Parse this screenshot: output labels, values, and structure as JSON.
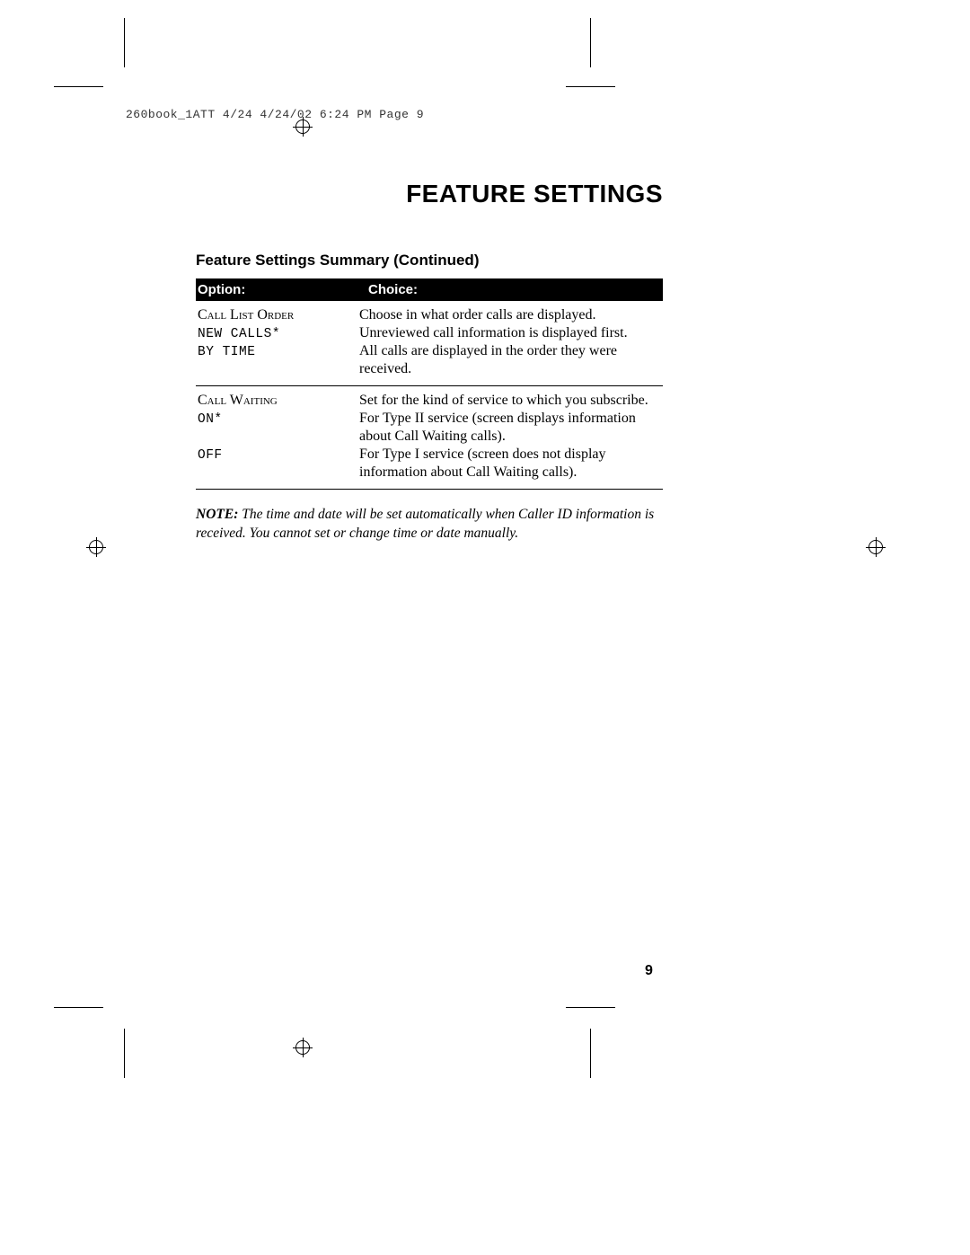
{
  "runhead": "260book_1ATT 4/24  4/24/02  6:24 PM  Page 9",
  "title": "FEATURE SETTINGS",
  "subtitle": "Feature Settings Summary (Continued)",
  "table": {
    "headers": {
      "option": "Option:",
      "choice": "Choice:"
    },
    "rows": [
      {
        "option_title": "Call List Order",
        "option_lines": [
          "NEW CALLS*",
          "BY TIME"
        ],
        "choice_lines": [
          "Choose in what order calls are displayed.",
          "Unreviewed call information is displayed first.",
          "All calls are displayed in the order they were received."
        ]
      },
      {
        "option_title": "Call Waiting",
        "option_lines": [
          "ON*",
          "",
          "OFF"
        ],
        "choice_lines": [
          "Set for the kind of service to which you subscribe.",
          "For Type II service (screen displays information about Call Waiting calls).",
          "For Type I service (screen does not display information about Call Waiting calls)."
        ]
      }
    ]
  },
  "note": {
    "label": "NOTE:",
    "text": "The time and date will be set automatically when Caller ID information is received. You cannot set or change time or date manually."
  },
  "page_number": "9"
}
